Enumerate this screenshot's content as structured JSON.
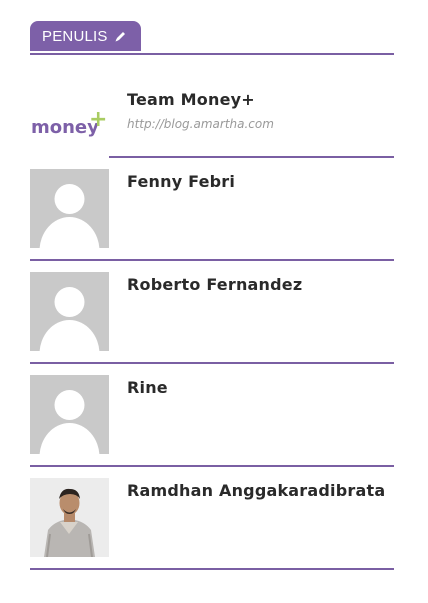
{
  "widget": {
    "badge_label": "PENULIS",
    "badge_icon": "pencil-icon"
  },
  "authors": [
    {
      "name": "Team Money+",
      "url": "http://blog.amartha.com",
      "avatar": "money-logo",
      "logo_text": "money",
      "logo_plus": "+"
    },
    {
      "name": "Fenny Febri",
      "avatar": "default-avatar-icon"
    },
    {
      "name": "Roberto Fernandez",
      "avatar": "default-avatar-icon"
    },
    {
      "name": "Rine",
      "avatar": "default-avatar-icon"
    },
    {
      "name": "Ramdhan Anggakaradibrata",
      "avatar": "person-photo"
    }
  ],
  "colors": {
    "accent": "#7d60a8",
    "divider": "#7a5fa3",
    "logo_green": "#a9cc62",
    "placeholder_gray": "#c9c9c9"
  }
}
